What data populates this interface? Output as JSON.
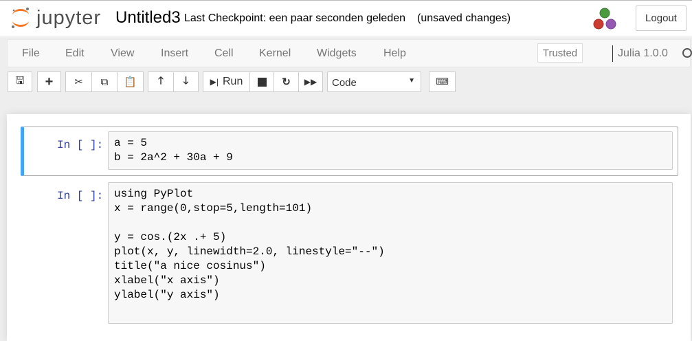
{
  "header": {
    "logo_text": "jupyter",
    "notebook_name": "Untitled3",
    "checkpoint": "Last Checkpoint: een paar seconden geleden",
    "unsaved": "(unsaved changes)",
    "logout": "Logout"
  },
  "menu": {
    "items": [
      "File",
      "Edit",
      "View",
      "Insert",
      "Cell",
      "Kernel",
      "Widgets",
      "Help"
    ],
    "trusted": "Trusted",
    "kernel": "Julia 1.0.0"
  },
  "toolbar": {
    "run": "Run",
    "cell_type": "Code"
  },
  "cells": [
    {
      "prompt": "In [ ]:",
      "code": "a = 5\nb = 2a^2 + 30a + 9"
    },
    {
      "prompt": "In [ ]:",
      "code": "using PyPlot\nx = range(0,stop=5,length=101)\n\ny = cos.(2x .+ 5)\nplot(x, y, linewidth=2.0, linestyle=\"--\")\ntitle(\"a nice cosinus\")\nxlabel(\"x axis\")\nylabel(\"y axis\")\n"
    }
  ],
  "colors": {
    "accent": "#42a5f5",
    "prompt": "#303f9f",
    "jupyter_orange": "#f37726"
  }
}
